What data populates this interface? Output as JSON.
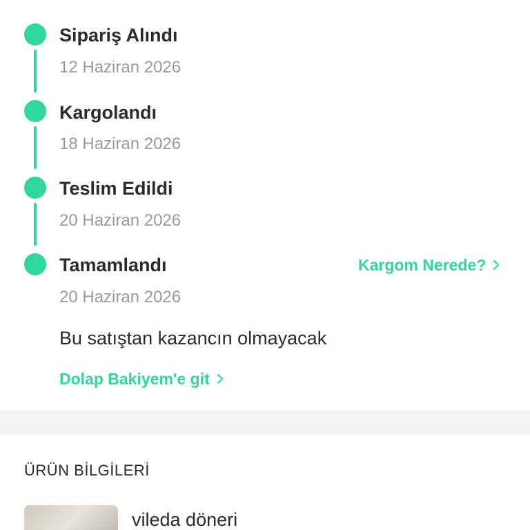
{
  "timeline": {
    "steps": [
      {
        "title": "Sipariş Alındı",
        "date": "12 Haziran 2026"
      },
      {
        "title": "Kargolandı",
        "date": "18 Haziran 2026"
      },
      {
        "title": "Teslim Edildi",
        "date": "20 Haziran 2026"
      },
      {
        "title": "Tamamlandı",
        "date": "20 Haziran 2026"
      }
    ],
    "track_link": "Kargom Nerede?",
    "earnings_note": "Bu satıştan kazancın olmayacak",
    "balance_link": "Dolap Bakiyem'e git"
  },
  "product_section": {
    "title": "ÜRÜN BİLGİLERİ",
    "product_name": "vileda döneri"
  },
  "colors": {
    "accent": "#2fd79a",
    "text": "#2b2b2b",
    "muted": "#9a9a9a",
    "divider": "#f3f3f3"
  }
}
